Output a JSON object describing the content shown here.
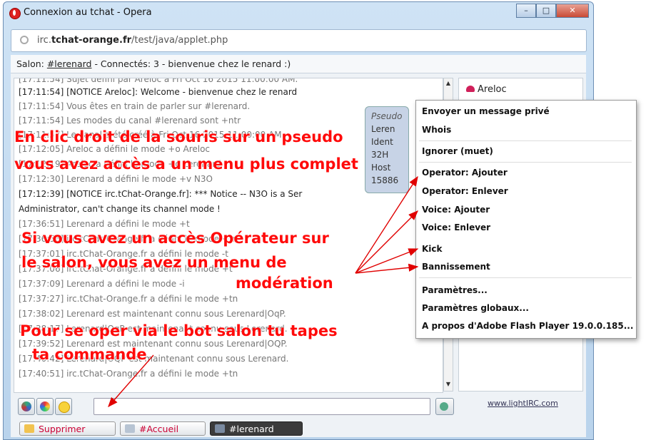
{
  "window": {
    "title": "Connexion au tchat - Opera",
    "buttons": {
      "minimize": "–",
      "maximize": "□",
      "close": "✕"
    }
  },
  "urlbar": {
    "host_prefix": "irc.",
    "host_bold": "tchat-orange.fr",
    "path": "/test/java/applet.php"
  },
  "topic": {
    "prefix": "Salon: ",
    "channel": "#lerenard",
    "suffix": " - Connectés: 3 - bienvenue chez le renard :)"
  },
  "chat": {
    "lines": [
      "[17:11:54] Sujet défini par Areloc à Fri Oct 16 2015 11:00:00 AM.",
      "[17:11:54] [NOTICE Areloc]: Welcome - bienvenue chez le renard",
      "[17:11:54] Vous êtes en train de parler sur #lerenard.",
      "[17:11:54] Les modes du canal #lerenard sont +ntr",
      "[17:11:57] Le canal a été créé à Fri Oct 16 2015 11:00:00 AM",
      "[17:12:05] Areloc a défini le mode +o Areloc",
      "[17:12:19] Areloc a défini le mode +o Lerenard",
      "[17:12:30] Lerenard a défini le mode +v N3O",
      "[17:12:39] [NOTICE irc.tChat-Orange.fr]: *** Notice -- N3O is a Ser",
      "Administrator, can't change its channel mode !",
      "[17:36:51] Lerenard a défini le mode +t",
      "[17:36:56] irc.tChat-Orange.fr a défini le mode +tn",
      "[17:37:01] irc.tChat-Orange.fr a défini le mode -t",
      "[17:37:06] irc.tChat-Orange.fr a défini le mode +t",
      "[17:37:09] Lerenard a défini le mode -i",
      "[17:37:27] irc.tChat-Orange.fr a défini le mode +tn",
      "[17:38:02] Lerenard est maintenant connu sous Lerenard|OqP.",
      "[17:38:17] Lerenard|OqP est maintenant connu sous Lerenard.",
      "[17:39:52] Lerenard est maintenant connu sous Lerenard|OQP.",
      "[17:40:42] Lerenard|OQP est maintenant connu sous Lerenard.",
      "[17:40:51] irc.tChat-Orange.fr a défini le mode +tn"
    ]
  },
  "tooltip": {
    "lines": [
      "Pseudo",
      "Leren",
      "Ident",
      "32H",
      "Host",
      "15886"
    ]
  },
  "users": [
    "Areloc"
  ],
  "context_menu": {
    "items": [
      "Envoyer un message privé",
      "Whois",
      "Ignorer (muet)",
      "Operator: Ajouter",
      "Operator: Enlever",
      "Voice: Ajouter",
      "Voice: Enlever",
      "Kick",
      "Bannissement",
      "Paramètres...",
      "Paramètres globaux...",
      "A propos d'Adobe Flash Player 19.0.0.185..."
    ]
  },
  "bottom": {
    "link": "www.lightIRC.com",
    "tabs": [
      "Supprimer",
      "#Accueil",
      "#lerenard"
    ]
  },
  "annotations": {
    "a1": "En clic droit de la souris sur un pseudo",
    "a2": "vous avez accès a un menu plus complet",
    "a3": "Si vous avez un accès Opérateur sur",
    "a4": "le salon, vous avez un menu de",
    "a5": "modération",
    "a6": "Pour se oper via le bot salon tu tapes",
    "a7": "ta commande"
  },
  "colors": {
    "annotation": "#ff0a0a",
    "active_tab": "#3b3b3b",
    "arrow": "#e00000"
  }
}
